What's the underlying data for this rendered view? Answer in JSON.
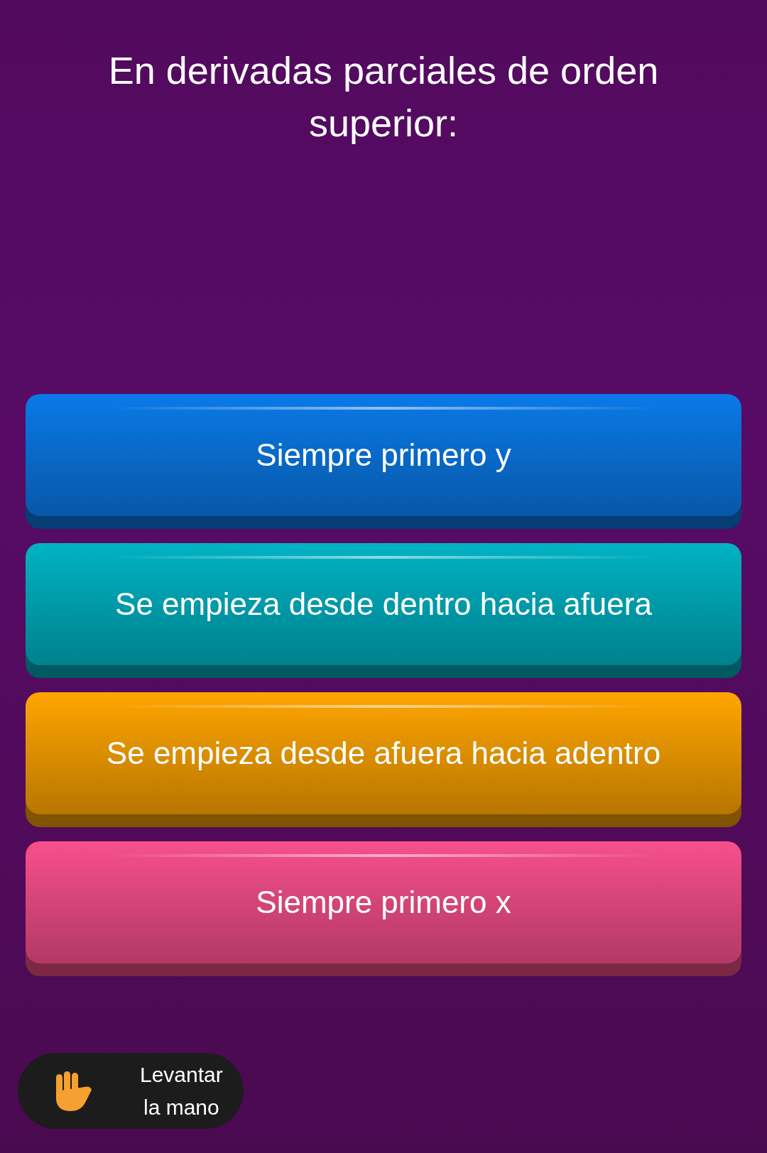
{
  "question": "En derivadas parciales de orden superior:",
  "options": [
    {
      "text": "Siempre primero y",
      "color": "#0a7ae8"
    },
    {
      "text": "Se empieza desde dentro hacia afuera",
      "color": "#00b3c4"
    },
    {
      "text": "Se empieza desde afuera hacia adentro",
      "color": "#ffa500"
    },
    {
      "text": "Siempre primero x",
      "color": "#f7508a"
    }
  ],
  "raise_hand": {
    "line_1": "Levantar",
    "line_2": "la mano"
  }
}
